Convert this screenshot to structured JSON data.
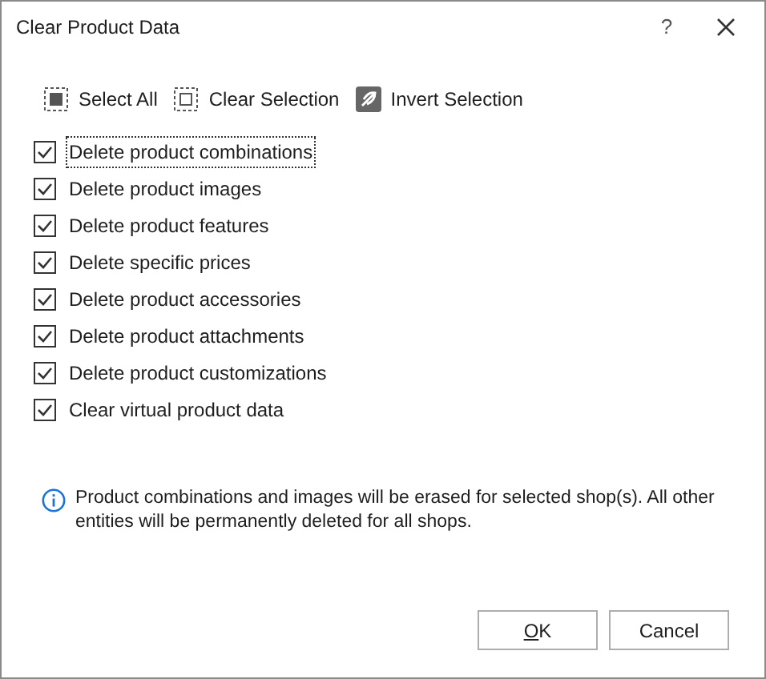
{
  "window": {
    "title": "Clear Product Data",
    "help": "?"
  },
  "toolbar": [
    {
      "kind": "select-all",
      "label": "Select All"
    },
    {
      "kind": "clear",
      "label": "Clear Selection"
    },
    {
      "kind": "invert",
      "label": "Invert Selection"
    }
  ],
  "options": [
    {
      "label": "Delete product combinations",
      "checked": true,
      "focused": true
    },
    {
      "label": "Delete product images",
      "checked": true,
      "focused": false
    },
    {
      "label": "Delete product features",
      "checked": true,
      "focused": false
    },
    {
      "label": "Delete specific prices",
      "checked": true,
      "focused": false
    },
    {
      "label": "Delete product accessories",
      "checked": true,
      "focused": false
    },
    {
      "label": "Delete product attachments",
      "checked": true,
      "focused": false
    },
    {
      "label": "Delete product customizations",
      "checked": true,
      "focused": false
    },
    {
      "label": "Clear virtual product data",
      "checked": true,
      "focused": false
    }
  ],
  "info": "Product combinations and images will be erased for selected shop(s). All other entities will be permanently deleted for all shops.",
  "buttons": [
    {
      "label": "OK",
      "mnemonic_first": true
    },
    {
      "label": "Cancel",
      "mnemonic_first": false
    }
  ]
}
